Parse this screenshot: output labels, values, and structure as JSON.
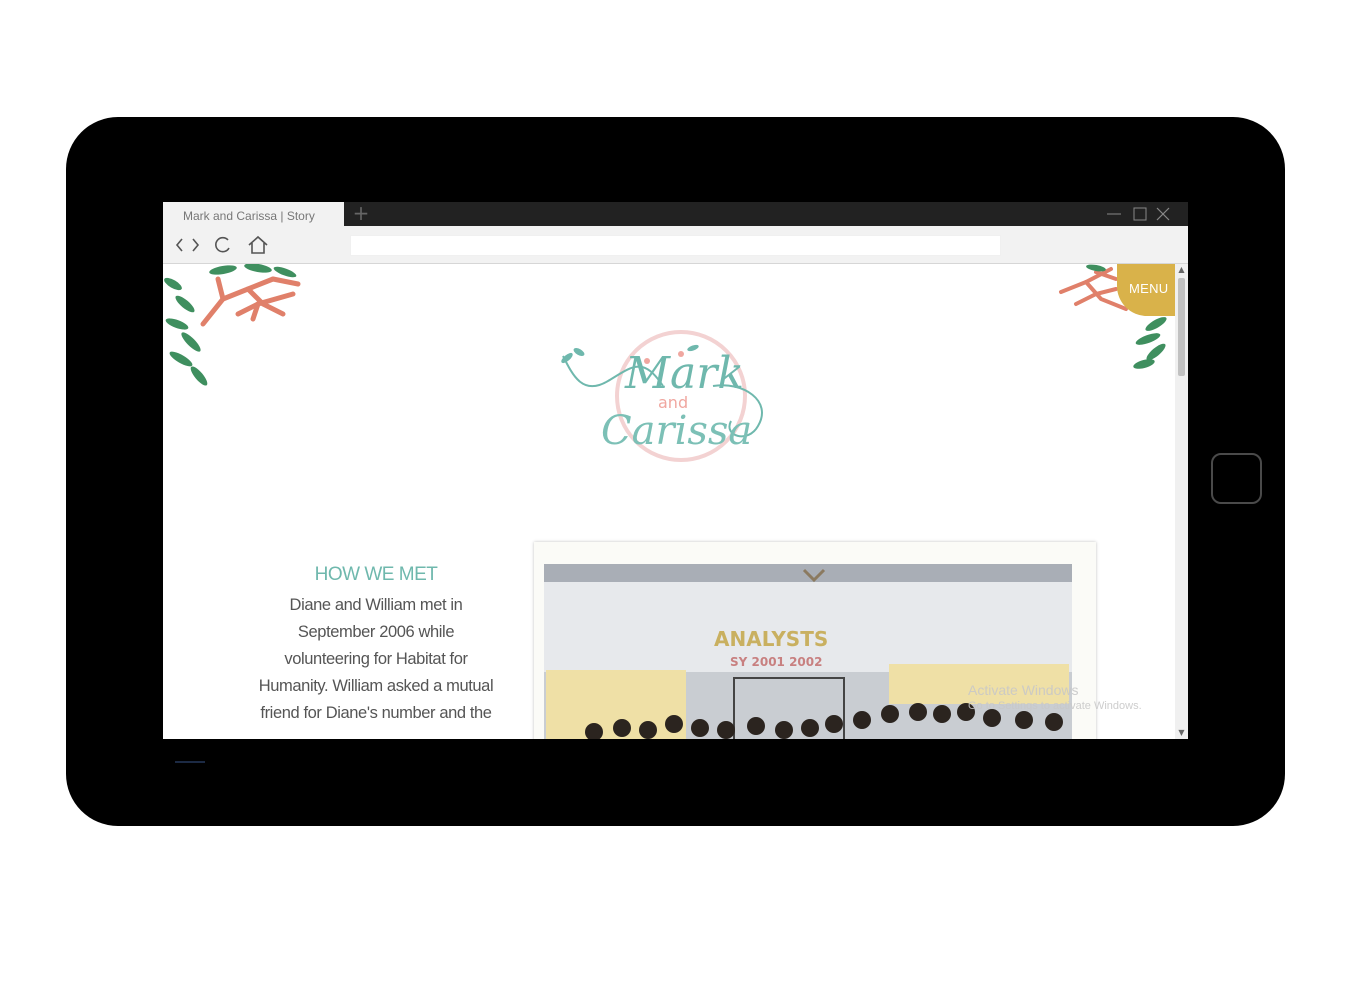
{
  "browser": {
    "tab_title": "Mark and Carissa | Story",
    "new_tab_icon": "plus-icon",
    "url": ""
  },
  "site": {
    "menu_label": "MENU",
    "logo_text": {
      "line1": "Mark",
      "line2": "and",
      "line3": "Carissa"
    }
  },
  "story": {
    "heading": "HOW WE MET",
    "lines": [
      "Diane and William met in",
      "September 2006 while",
      "volunteering for Habitat for",
      "Humanity. William asked a mutual",
      "friend for Diane's number and the"
    ]
  },
  "photo": {
    "banner_title": "ANALYSTS",
    "banner_sub": "SY 2001  2002"
  },
  "watermark": {
    "line1": "Activate Windows",
    "line2": "Go to Settings to activate Windows."
  },
  "colors": {
    "accent_teal": "#6fb8ad",
    "menu_gold": "#d9b24a",
    "coral": "#e0806a",
    "leaf_green": "#3f8f5f"
  }
}
